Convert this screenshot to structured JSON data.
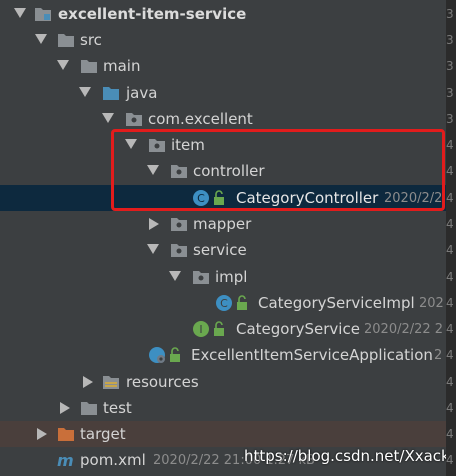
{
  "tree": {
    "root": {
      "label": "excellent-item-service"
    },
    "src": {
      "label": "src"
    },
    "main": {
      "label": "main"
    },
    "java": {
      "label": "java"
    },
    "com_excellent": {
      "label": "com.excellent"
    },
    "item": {
      "label": "item"
    },
    "controller": {
      "label": "controller"
    },
    "category_controller": {
      "label": "CategoryController",
      "meta": "2020/2/2"
    },
    "mapper": {
      "label": "mapper"
    },
    "service": {
      "label": "service"
    },
    "impl": {
      "label": "impl"
    },
    "category_service_impl": {
      "label": "CategoryServiceImpl",
      "meta": "202"
    },
    "category_service": {
      "label": "CategoryService",
      "meta": "2020/2/22 2"
    },
    "application": {
      "label": "ExcellentItemServiceApplication",
      "meta": "2"
    },
    "resources": {
      "label": "resources"
    },
    "test": {
      "label": "test"
    },
    "target": {
      "label": "target"
    },
    "pom": {
      "label": "pom.xml",
      "meta": "2020/2/22 21:00 1.27 kB"
    }
  },
  "watermark": "https://blog.csdn.net/Xxacker",
  "gutter_marks": [
    "3",
    "3",
    "3",
    "3",
    "3",
    "4",
    "4",
    "4",
    "4",
    "4",
    "4",
    "4",
    "4",
    "4",
    "4",
    "4",
    "4",
    "4"
  ],
  "colors": {
    "background": "#3c3f41",
    "selection": "#0d293e",
    "highlight": "#e21c1c",
    "folder": "#8a8f93",
    "source_folder": "#4a8db7",
    "resources_folder": "#9b8c5c",
    "excluded_folder": "#c96f3a",
    "class_icon": "#3d8fc2",
    "interface_icon": "#6aa84f"
  }
}
